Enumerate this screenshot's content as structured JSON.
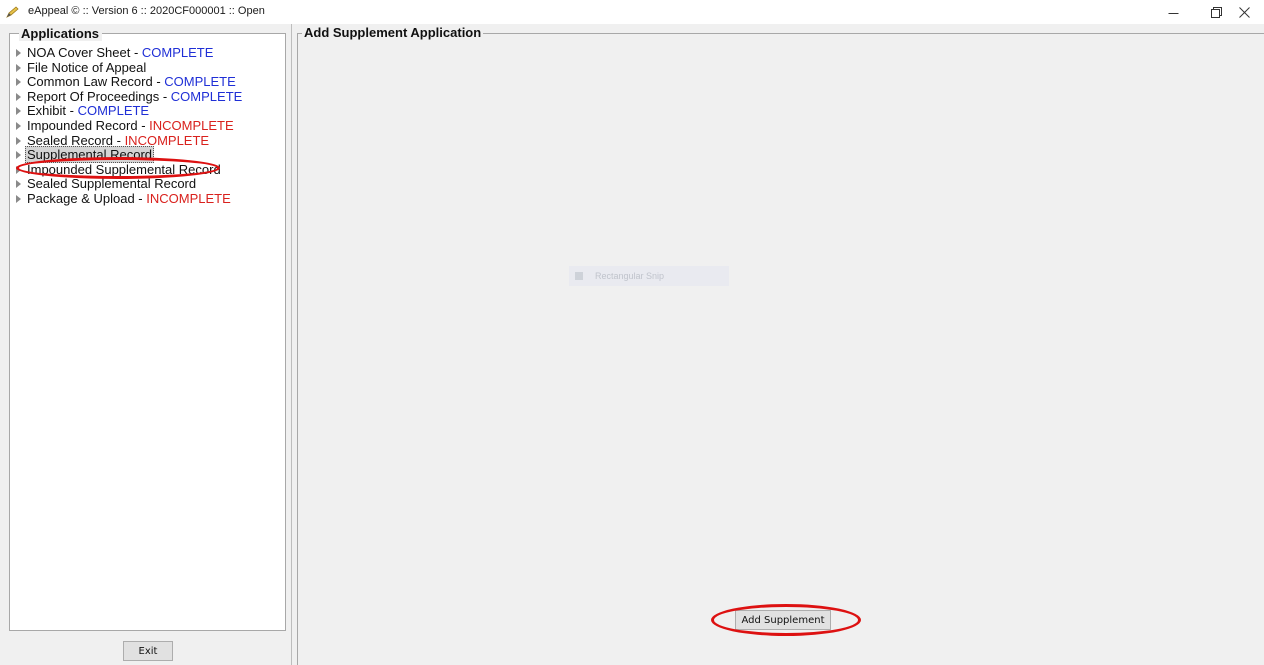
{
  "window": {
    "title": "eAppeal © :: Version 6 :: 2020CF000001 :: Open",
    "icon": "pencil-icon",
    "controls": [
      "minimize-icon",
      "maximize-icon",
      "close-icon"
    ]
  },
  "left_panel": {
    "legend": "Applications",
    "items": [
      {
        "label": "NOA Cover Sheet",
        "status": "COMPLETE",
        "selected": false
      },
      {
        "label": "File Notice of Appeal",
        "status": "",
        "selected": false
      },
      {
        "label": "Common Law Record",
        "status": "COMPLETE",
        "selected": false
      },
      {
        "label": "Report Of Proceedings",
        "status": "COMPLETE",
        "selected": false
      },
      {
        "label": "Exhibit",
        "status": "COMPLETE",
        "selected": false
      },
      {
        "label": "Impounded Record",
        "status": "INCOMPLETE",
        "selected": false
      },
      {
        "label": "Sealed Record",
        "status": "INCOMPLETE",
        "selected": false
      },
      {
        "label": "Supplemental Record",
        "status": "",
        "selected": true
      },
      {
        "label": "Impounded Supplemental Record",
        "status": "",
        "selected": false
      },
      {
        "label": "Sealed Supplemental Record",
        "status": "",
        "selected": false
      },
      {
        "label": "Package & Upload",
        "status": "INCOMPLETE",
        "selected": false
      }
    ],
    "separator": " - ",
    "exit_label": "Exit"
  },
  "main": {
    "legend": "Add Supplement Application",
    "ghost_label": "Rectangular Snip",
    "add_button_label": "Add Supplement"
  },
  "colors": {
    "complete": "#1f2fd6",
    "incomplete": "#d9211d",
    "annotation": "#dd1111",
    "background": "#f0f0f0"
  }
}
